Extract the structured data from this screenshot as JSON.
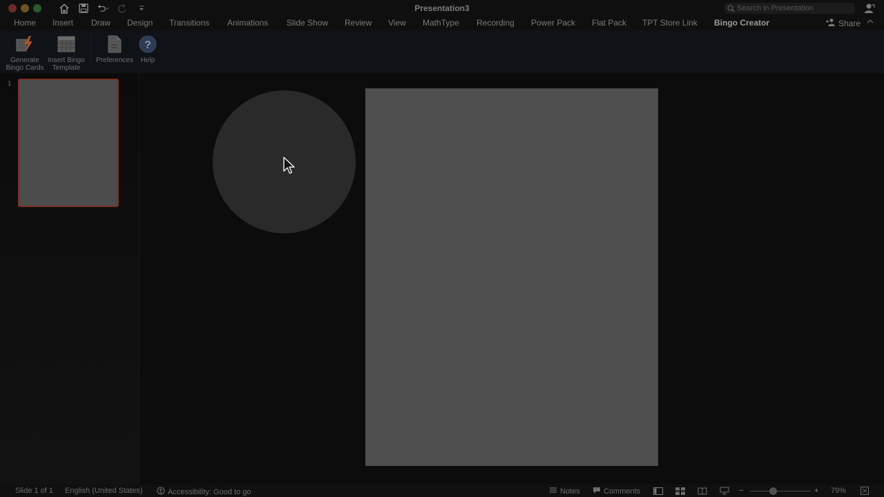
{
  "window": {
    "title": "Presentation3"
  },
  "search": {
    "placeholder": "Search in Presentation"
  },
  "tabs": [
    {
      "label": "Home"
    },
    {
      "label": "Insert"
    },
    {
      "label": "Draw"
    },
    {
      "label": "Design"
    },
    {
      "label": "Transitions"
    },
    {
      "label": "Animations"
    },
    {
      "label": "Slide Show"
    },
    {
      "label": "Review"
    },
    {
      "label": "View"
    },
    {
      "label": "MathType"
    },
    {
      "label": "Recording"
    },
    {
      "label": "Power Pack"
    },
    {
      "label": "Flat Pack"
    },
    {
      "label": "TPT Store Link"
    },
    {
      "label": "Bingo Creator"
    }
  ],
  "share": {
    "label": "Share"
  },
  "ribbon": {
    "generate": "Generate\nBingo Cards",
    "insert_template": "Insert Bingo\nTemplate",
    "preferences": "Preferences",
    "help": "Help"
  },
  "thumbnails": {
    "slide_number": "1"
  },
  "status": {
    "slide": "Slide 1 of 1",
    "language": "English (United States)",
    "accessibility": "Accessibility: Good to go",
    "notes": "Notes",
    "comments": "Comments",
    "zoom": "79%",
    "zoom_level": 0.79
  },
  "colors": {
    "selection_border": "#7a2f24",
    "slide_fill": "#4e4e4e",
    "spotlight": "#2a2a2a"
  }
}
